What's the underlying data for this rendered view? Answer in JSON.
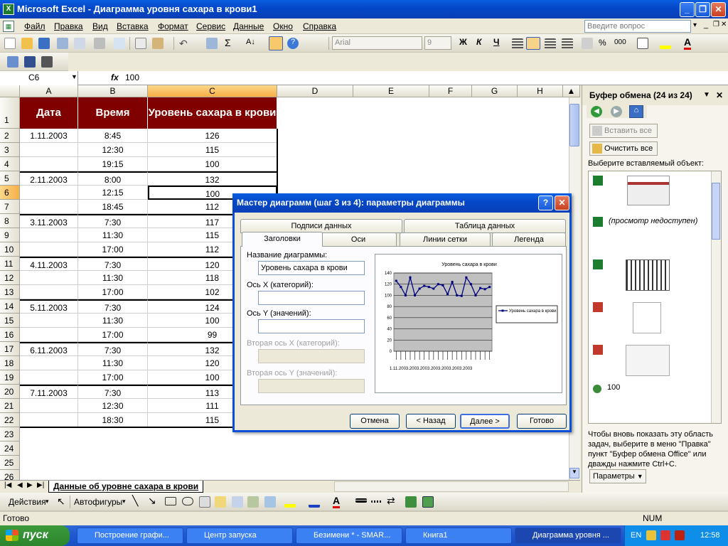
{
  "window": {
    "title": "Microsoft Excel - Диаграмма уровня сахара в крови1",
    "app_icon": "excel-icon"
  },
  "menu": {
    "items": [
      "Файл",
      "Правка",
      "Вид",
      "Вставка",
      "Формат",
      "Сервис",
      "Данные",
      "Окно",
      "Справка"
    ],
    "help_placeholder": "Введите вопрос"
  },
  "format_toolbar": {
    "font": "Arial",
    "size": "9",
    "bold": "Ж",
    "italic": "К",
    "underline": "Ч",
    "percent": "%",
    "thousands": "000"
  },
  "formula_bar": {
    "cell_ref": "C6",
    "fx": "fx",
    "value": "100"
  },
  "columns": [
    "A",
    "B",
    "C",
    "D",
    "E",
    "F",
    "G",
    "H"
  ],
  "headers": {
    "date": "Дата",
    "time": "Время",
    "level": "Уровень сахара в крови"
  },
  "rows": [
    {
      "n": "2",
      "date": "1.11.2003",
      "time": "8:45",
      "level": "126"
    },
    {
      "n": "3",
      "date": "",
      "time": "12:30",
      "level": "115"
    },
    {
      "n": "4",
      "date": "",
      "time": "19:15",
      "level": "100"
    },
    {
      "n": "5",
      "date": "2.11.2003",
      "time": "8:00",
      "level": "132"
    },
    {
      "n": "6",
      "date": "",
      "time": "12:15",
      "level": "100"
    },
    {
      "n": "7",
      "date": "",
      "time": "18:45",
      "level": "112"
    },
    {
      "n": "8",
      "date": "3.11.2003",
      "time": "7:30",
      "level": "117"
    },
    {
      "n": "9",
      "date": "",
      "time": "11:30",
      "level": "115"
    },
    {
      "n": "10",
      "date": "",
      "time": "17:00",
      "level": "112"
    },
    {
      "n": "11",
      "date": "4.11.2003",
      "time": "7:30",
      "level": "120"
    },
    {
      "n": "12",
      "date": "",
      "time": "11:30",
      "level": "118"
    },
    {
      "n": "13",
      "date": "",
      "time": "17:00",
      "level": "102"
    },
    {
      "n": "14",
      "date": "5.11.2003",
      "time": "7:30",
      "level": "124"
    },
    {
      "n": "15",
      "date": "",
      "time": "11:30",
      "level": "100"
    },
    {
      "n": "16",
      "date": "",
      "time": "17:00",
      "level": "99"
    },
    {
      "n": "17",
      "date": "6.11.2003",
      "time": "7:30",
      "level": "132"
    },
    {
      "n": "18",
      "date": "",
      "time": "11:30",
      "level": "120"
    },
    {
      "n": "19",
      "date": "",
      "time": "17:00",
      "level": "100"
    },
    {
      "n": "20",
      "date": "7.11.2003",
      "time": "7:30",
      "level": "113"
    },
    {
      "n": "21",
      "date": "",
      "time": "12:30",
      "level": "111"
    },
    {
      "n": "22",
      "date": "",
      "time": "18:30",
      "level": "115"
    }
  ],
  "empty_rows": [
    "23",
    "24",
    "25",
    "26"
  ],
  "header_row_number": "1",
  "sheet_tab": "Данные об уровне сахара в крови",
  "draw_toolbar": {
    "actions": "Действия",
    "autoshapes": "Автофигуры"
  },
  "status": {
    "left": "Готово",
    "num": "NUM"
  },
  "taskbar": {
    "start": "пуск",
    "tasks": [
      "Построение графи...",
      "Центр запуска",
      "Безимени * - SMAR...",
      "Книга1",
      "Диаграмма уровня ..."
    ],
    "lang": "EN",
    "clock": "12:58"
  },
  "task_pane": {
    "title": "Буфер обмена (24 из 24)",
    "paste_all": "Вставить все",
    "clear_all": "Очистить все",
    "choose": "Выберите вставляемый объект:",
    "no_preview": "(просмотр недоступен)",
    "clip_text": "100",
    "hint": "Чтобы вновь показать эту область задач, выберите в меню \"Правка\" пункт \"Буфер обмена Office\" или дважды нажмите Ctrl+C.",
    "options": "Параметры"
  },
  "dialog": {
    "title": "Мастер диаграмм (шаг 3 из 4): параметры диаграммы",
    "tabs_back": [
      "Подписи данных",
      "Таблица данных"
    ],
    "tabs_front": [
      "Заголовки",
      "Оси",
      "Линии сетки",
      "Легенда"
    ],
    "fields": [
      {
        "label": "Название диаграммы:",
        "value": "Уровень сахара в крови",
        "disabled": false
      },
      {
        "label": "Ось X (категорий):",
        "value": "",
        "disabled": false
      },
      {
        "label": "Ось Y (значений):",
        "value": "",
        "disabled": false
      },
      {
        "label": "Вторая ось X (категорий):",
        "value": "",
        "disabled": true
      },
      {
        "label": "Вторая ось Y (значений):",
        "value": "",
        "disabled": true
      }
    ],
    "buttons": {
      "cancel": "Отмена",
      "back": "< Назад",
      "next": "Далее >",
      "finish": "Готово"
    },
    "help": "?",
    "close": "✕"
  },
  "chart_data": {
    "type": "line",
    "title": "Уровень сахара в крови",
    "categories": [
      "1.11.2003",
      "",
      "",
      "2.11.2003",
      "",
      "",
      "3.11.2003",
      "",
      "",
      "4.11.2003",
      "",
      "",
      "5.11.2003",
      "",
      "",
      "6.11.2003",
      "",
      "",
      "7.11.2003",
      "",
      ""
    ],
    "series": [
      {
        "name": "Уровень сахара в крови",
        "values": [
          126,
          115,
          100,
          132,
          100,
          112,
          117,
          115,
          112,
          120,
          118,
          102,
          124,
          100,
          99,
          132,
          120,
          100,
          113,
          111,
          115
        ]
      }
    ],
    "ylim": [
      0,
      140
    ],
    "yticks": [
      "0",
      "20",
      "40",
      "60",
      "80",
      "100",
      "120",
      "140"
    ],
    "x_tick_text": "1.11.2003.2003.2003.2003.2003.2003.2003",
    "grid": true,
    "legend": "right",
    "plot_bg": "#c0c0c0",
    "line_color": "#000080"
  }
}
